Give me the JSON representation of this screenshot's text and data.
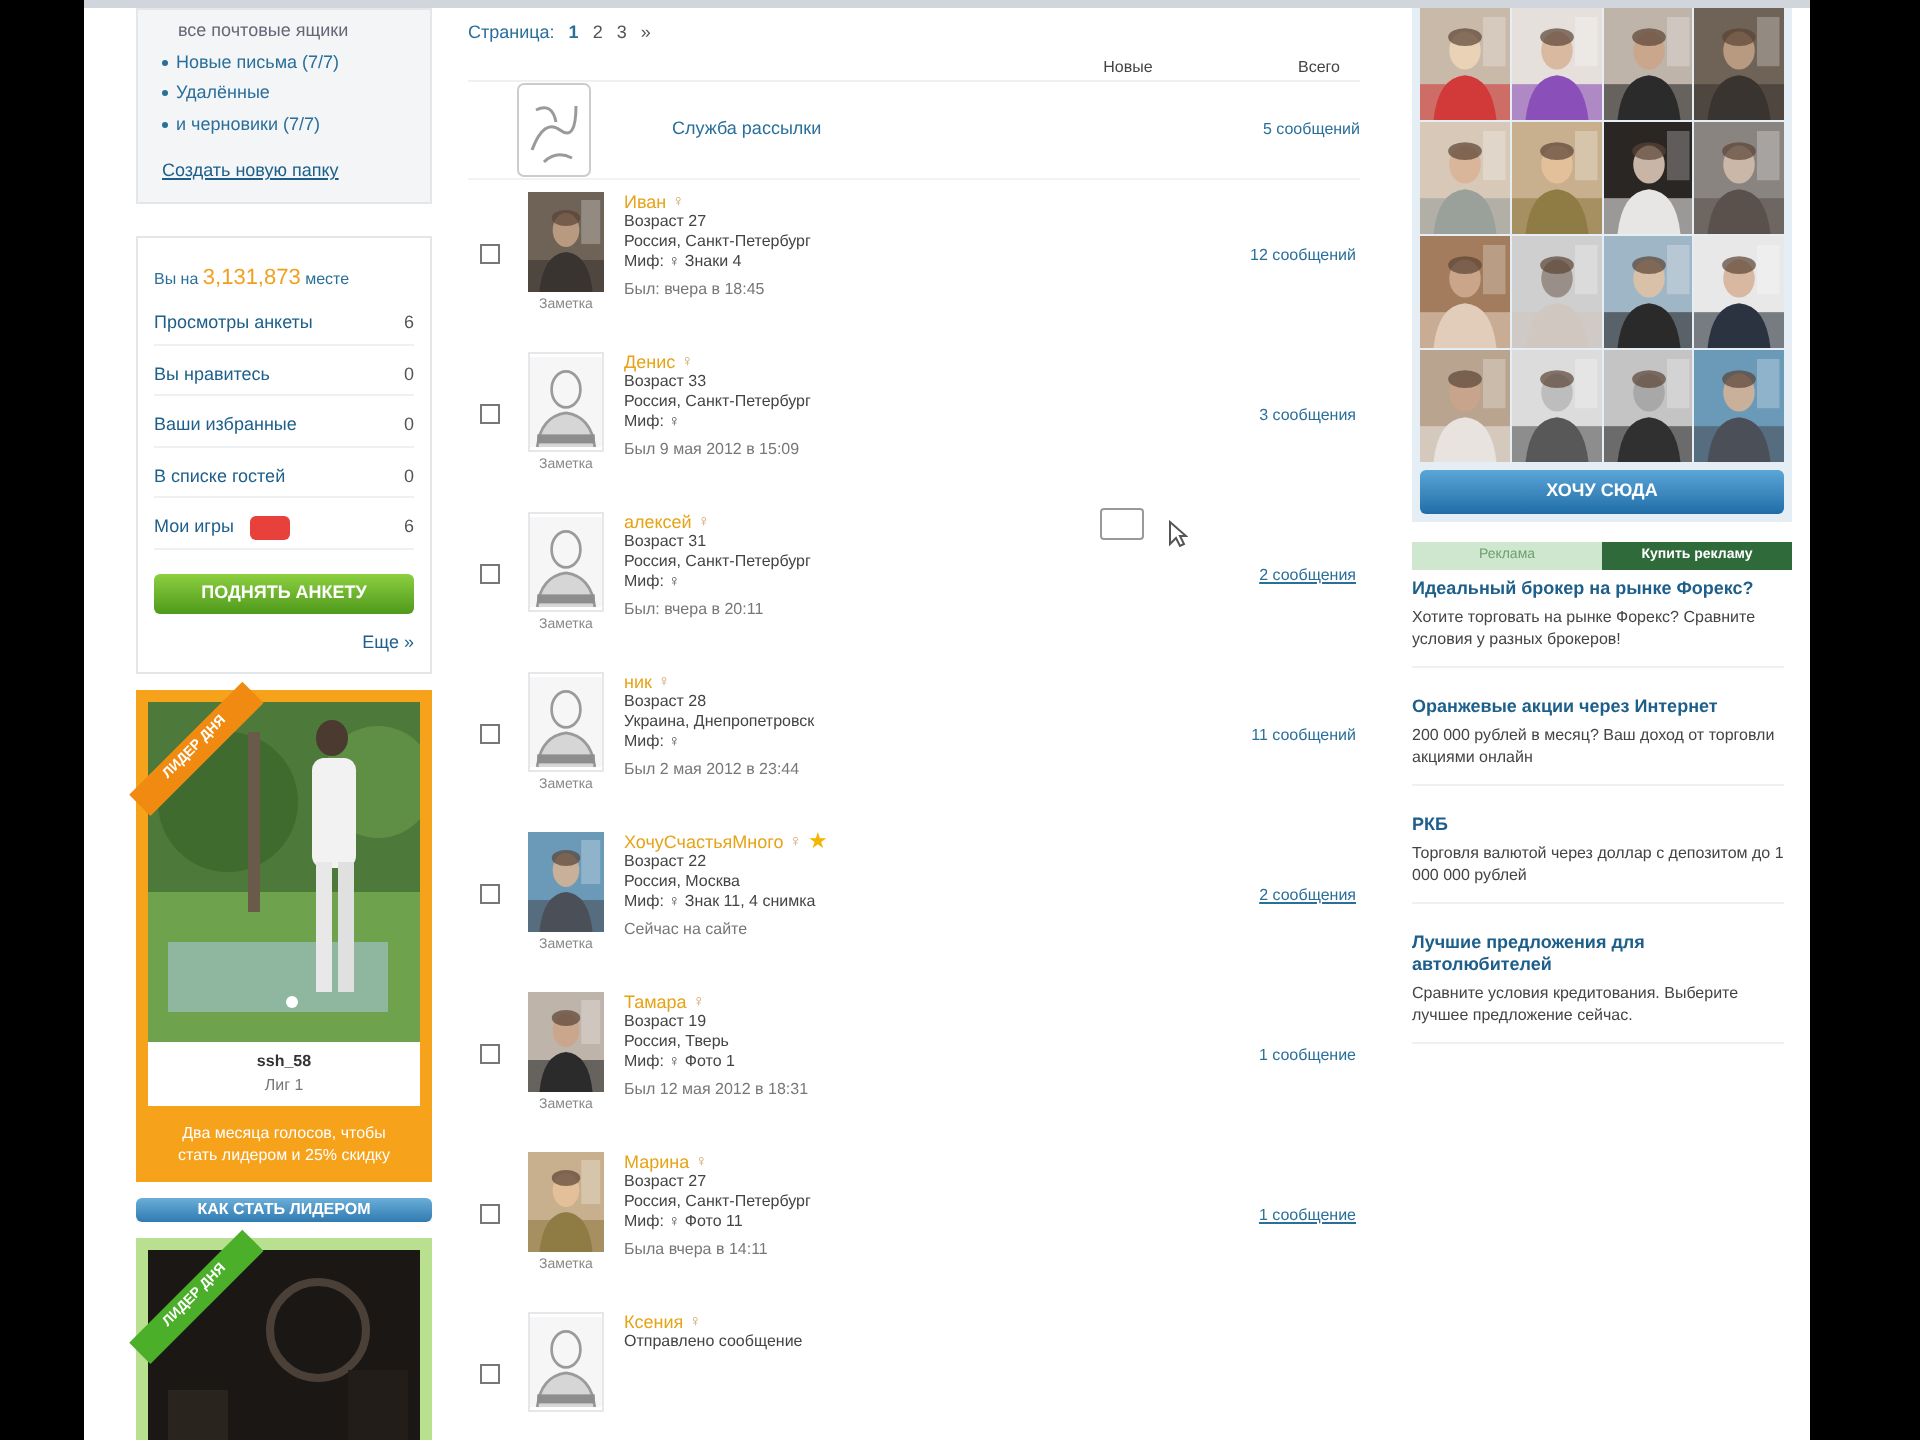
{
  "folders": {
    "title": "все почтовые ящики",
    "items": [
      {
        "label": "Новые письма (7/7)"
      },
      {
        "label": "Удалённые"
      },
      {
        "label": "и черновики (7/7)"
      }
    ],
    "create_link": "Создать новую папку"
  },
  "stats": {
    "rank_prefix": "Вы на",
    "rank": "3,131,873",
    "rank_suffix": "месте",
    "rows": [
      {
        "label": "Просмотры анкеты",
        "count": "6",
        "badge": false
      },
      {
        "label": "Вы нравитесь",
        "count": "0",
        "badge": false
      },
      {
        "label": "Ваши избранные",
        "count": "0",
        "badge": false
      },
      {
        "label": "В списке гостей",
        "count": "0",
        "badge": false
      },
      {
        "label": "Мои игры",
        "count": "6",
        "badge": true
      }
    ],
    "button": "ПОДНЯТЬ АНКЕТУ",
    "more": "Еще »"
  },
  "promo_cards": [
    {
      "ribbon": "ЛИДЕР ДНЯ",
      "caption": "ssh_58",
      "subcaption": "Лиг 1",
      "footer": "Два месяца голосов, чтобы\nстать лидером и 25% скидку"
    },
    {
      "ribbon": "ЛИДЕР ДНЯ"
    }
  ],
  "leader_button": "КАК СТАТЬ ЛИДЕРОМ",
  "pagination": {
    "label": "Страница:",
    "pages": [
      {
        "label": "1",
        "selected": true
      },
      {
        "label": "2",
        "selected": false
      },
      {
        "label": "3",
        "selected": false
      },
      {
        "label": "»",
        "selected": false
      }
    ]
  },
  "columns": [
    {
      "label": "Новые"
    },
    {
      "label": "Всего"
    }
  ],
  "conversations": [
    {
      "kind": "service",
      "name": "Служба рассылки",
      "total": "5 сообщений"
    },
    {
      "kind": "user",
      "avatar": {
        "kind": "picture"
      },
      "name": "Иван",
      "sign": "♀",
      "lines": [
        "Возраст 27",
        "Россия, Санкт-Петербург",
        "Миф: ♀ Знаки 4"
      ],
      "last_visit": "Был: вчера в 18:45",
      "note": "Заметка",
      "total": "12 сообщений",
      "underlined": false,
      "checked": false
    },
    {
      "kind": "user",
      "avatar": {
        "kind": "placeholder"
      },
      "name": "Денис",
      "sign": "♀",
      "lines": [
        "Возраст 33",
        "Россия, Санкт-Петербург",
        "Миф: ♀"
      ],
      "last_visit": "Был 9 мая 2012 в 15:09",
      "note": "Заметка",
      "total": "3 сообщения",
      "underlined": false,
      "checked": false
    },
    {
      "kind": "user",
      "avatar": {
        "kind": "placeholder"
      },
      "name": "алексей",
      "sign": "♀",
      "lines": [
        "Возраст 31",
        "Россия, Санкт-Петербург",
        "Миф: ♀"
      ],
      "last_visit": "Был: вчера в 20:11",
      "note": "Заметка",
      "total": "2 сообщения",
      "underlined": true,
      "checked": false
    },
    {
      "kind": "user",
      "avatar": {
        "kind": "placeholder"
      },
      "name": "ник",
      "sign": "♀",
      "lines": [
        "Возраст 28",
        "Украина, Днепропетровск",
        "Миф: ♀"
      ],
      "last_visit": "Был 2 мая 2012 в 23:44",
      "note": "Заметка",
      "total": "11 сообщений",
      "underlined": false,
      "checked": false
    },
    {
      "kind": "user",
      "avatar": {
        "kind": "picture"
      },
      "name": "ХочуСчастьяМного",
      "sign": "♀",
      "star": "★",
      "lines": [
        "Возраст 22",
        "Россия, Москва",
        "Миф: ♀ Знак 11, 4 снимка"
      ],
      "last_visit": "Сейчас на сайте",
      "note": "Заметка",
      "total": "2 сообщения",
      "underlined": true,
      "checked": false
    },
    {
      "kind": "user",
      "avatar": {
        "kind": "picture"
      },
      "name": "Тамара",
      "sign": "♀",
      "lines": [
        "Возраст 19",
        "Россия, Тверь",
        "Миф: ♀ Фото 1"
      ],
      "last_visit": "Был 12 мая 2012 в 18:31",
      "note": "Заметка",
      "total": "1 сообщение",
      "underlined": false,
      "checked": false
    },
    {
      "kind": "user",
      "avatar": {
        "kind": "picture"
      },
      "name": "Марина",
      "sign": "♀",
      "lines": [
        "Возраст 27",
        "Россия, Санкт-Петербург",
        "Миф: ♀ Фото 11"
      ],
      "last_visit": "Была вчера в 14:11",
      "note": "Заметка",
      "total": "1 сообщение",
      "underlined": true,
      "checked": false
    },
    {
      "kind": "user",
      "avatar": {
        "kind": "placeholder"
      },
      "name": "Ксения",
      "sign": "♀",
      "lines": [
        "Отправлено сообщение"
      ],
      "checked": false
    }
  ],
  "grid_button": "ХОЧУ СЮДА",
  "ad_tabs": [
    {
      "label": "Реклама",
      "selected": false
    },
    {
      "label": "Купить рекламу",
      "selected": true
    }
  ],
  "ads": [
    {
      "title": "Идеальный брокер на рынке Форекс?",
      "text": "Хотите торговать на рынке Форекс? Сравните условия у разных брокеров!"
    },
    {
      "title": "Оранжевые акции через Интернет",
      "text": "200 000 рублей в месяц? Ваш доход от торговли акциями онлайн"
    },
    {
      "title": "РКБ",
      "text": "Торговля валютой через доллар с депозитом до 1 000 000 рублей"
    },
    {
      "title": "Лучшие предложения для автолюбителей",
      "text": "Сравните условия кредитования. Выберите лучшее предложение сейчас."
    }
  ]
}
